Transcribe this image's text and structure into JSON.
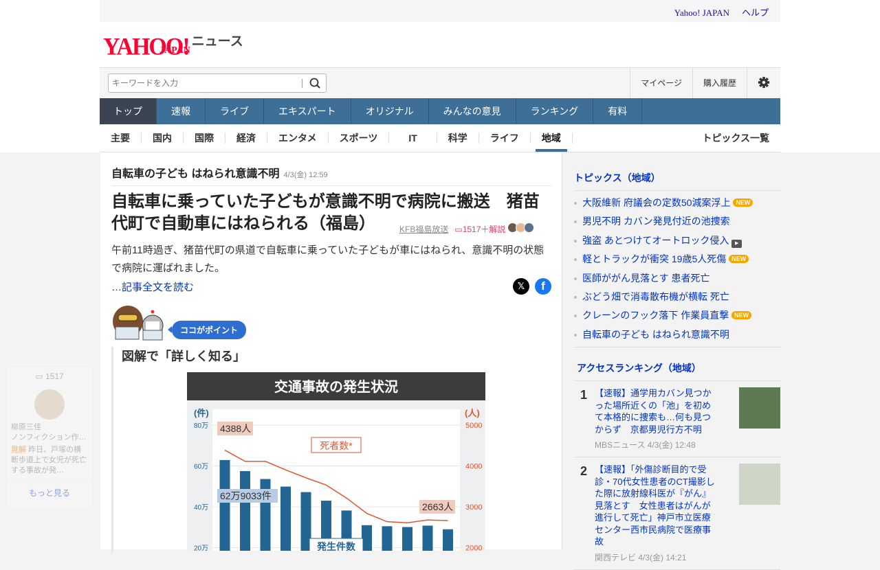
{
  "topbar": {
    "links": [
      "Yahoo! JAPAN",
      "ヘルプ"
    ]
  },
  "logo": {
    "brand": "YAHOO!",
    "sub": "JAPAN",
    "service": "ニュース"
  },
  "search": {
    "placeholder": "キーワードを入力"
  },
  "header_links": [
    "マイページ",
    "購入履歴"
  ],
  "global_nav": [
    "トップ",
    "速報",
    "ライブ",
    "エキスパート",
    "オリジナル",
    "みんなの意見",
    "ランキング",
    "有料"
  ],
  "sub_nav": [
    "主要",
    "国内",
    "国際",
    "経済",
    "エンタメ",
    "スポーツ",
    "IT",
    "科学",
    "ライフ",
    "地域"
  ],
  "sub_nav_all": "トピックス一覧",
  "article": {
    "topic": "自転車の子ども はねられ意識不明",
    "topic_time": "4/3(金) 12:59",
    "title": "自転車に乗っていた子どもが意識不明で病院に搬送　猪苗代町で自動車にはねられる（福島）",
    "source": "KFB福島放送",
    "comments": "1517＋解説",
    "lead": "午前11時過ぎ、猪苗代町の県道で自転車に乗っていた子どもが車にはねられ、意識不明の状態で病院に運ばれました。",
    "read_more": "…記事全文を読む",
    "point_label": "ココがポイント",
    "section_title": "図解で「詳しく知る」"
  },
  "chart_data": {
    "type": "bar",
    "title": "交通事故の発生状況",
    "left_unit": "(件)",
    "right_unit": "(人)",
    "left_ticks": [
      "80万",
      "60万",
      "40万",
      "20万"
    ],
    "right_ticks": [
      "5000",
      "4000",
      "3000",
      "2000"
    ],
    "ylim_left": [
      200000,
      800000
    ],
    "ylim_right": [
      2000,
      5000
    ],
    "series": [
      {
        "name": "発生件数",
        "type": "bar",
        "values": [
          629033,
          575000,
          536000,
          499000,
          472000,
          430000,
          382000,
          310000,
          305000,
          301000,
          308000,
          290000
        ]
      },
      {
        "name": "死者数*",
        "type": "line",
        "values": [
          4388,
          4113,
          4113,
          3904,
          3710,
          3532,
          3215,
          2839,
          2636,
          2610,
          2678,
          2663
        ]
      }
    ],
    "annotations": [
      "4388人",
      "62万9033件",
      "2663人"
    ]
  },
  "float_card": {
    "comments": "1517",
    "name": "柳原三佳",
    "role": "ノンフィクション作…",
    "tag": "見解",
    "text": "昨日、戸塚の横断歩道上で女児が死亡する事故が発…",
    "more": "もっと見る"
  },
  "sidebar": {
    "topics_title": "トピックス（地域）",
    "topics": [
      {
        "text": "大阪維新 府議会の定数50減案浮上",
        "badge": "NEW"
      },
      {
        "text": "男児不明 カバン発見付近の池捜索",
        "badge": ""
      },
      {
        "text": "強盗 あとつけてオートロック侵入",
        "badge": "video"
      },
      {
        "text": "軽とトラックが衝突 19歳5人死傷",
        "badge": "NEW"
      },
      {
        "text": "医師ががん見落とす 患者死亡",
        "badge": ""
      },
      {
        "text": "ぶどう畑で消毒散布機が横転 死亡",
        "badge": ""
      },
      {
        "text": "クレーンのフック落下 作業員直撃",
        "badge": "NEW"
      },
      {
        "text": "自転車の子ども はねられ意識不明",
        "badge": ""
      }
    ],
    "ranking_title": "アクセスランキング（地域）",
    "ranking": [
      {
        "rank": "1",
        "title": "【速報】通学用カバン見つかった場所近くの「池」を初めて本格的に捜索も…何も見つからず　京都男児行方不明",
        "meta": "MBSニュース 4/3(金) 12:48"
      },
      {
        "rank": "2",
        "title": "【速報】「外傷診断目的で受診・70代女性患者のCT撮影した際に放射線科医が『がん』見落とす　女性患者はがんが進行して死亡」神戸市立医療センター西市民病院で医療事故",
        "meta": "関西テレビ 4/3(金) 14:21"
      }
    ]
  }
}
